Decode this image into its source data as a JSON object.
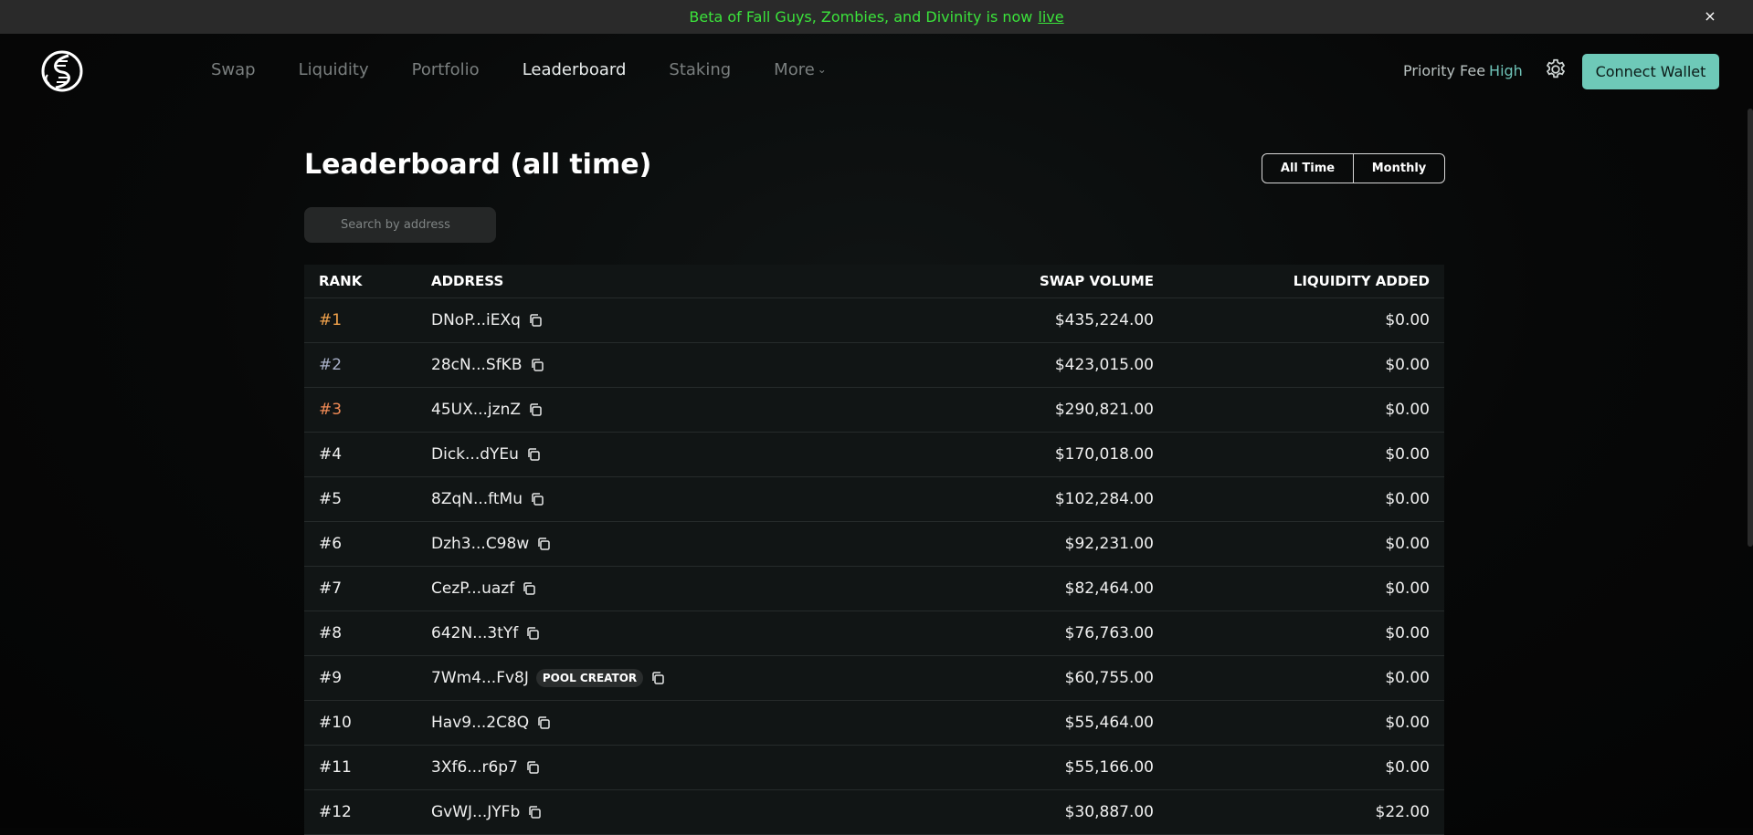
{
  "banner": {
    "text": "Beta of Fall Guys, Zombies, and Divinity is now",
    "link": "live",
    "close": "×"
  },
  "nav": {
    "items": [
      {
        "label": "Swap",
        "active": false
      },
      {
        "label": "Liquidity",
        "active": false
      },
      {
        "label": "Portfolio",
        "active": false
      },
      {
        "label": "Leaderboard",
        "active": true
      },
      {
        "label": "Staking",
        "active": false
      },
      {
        "label": "More",
        "active": false
      }
    ],
    "priority_label": "Priority Fee",
    "priority_level": "High",
    "connect_label": "Connect Wallet"
  },
  "main": {
    "title": "Leaderboard (all time)",
    "toggle": [
      "All Time",
      "Monthly"
    ],
    "search_placeholder": "Search by address"
  },
  "table": {
    "headers": [
      "RANK",
      "ADDRESS",
      "SWAP VOLUME",
      "LIQUIDITY ADDED"
    ],
    "rows": [
      {
        "rank": "#1",
        "address": "DNoP...iEXq",
        "badge": "",
        "volume": "$435,224.00",
        "liquidity": "$0.00"
      },
      {
        "rank": "#2",
        "address": "28cN...SfKB",
        "badge": "",
        "volume": "$423,015.00",
        "liquidity": "$0.00"
      },
      {
        "rank": "#3",
        "address": "45UX...jznZ",
        "badge": "",
        "volume": "$290,821.00",
        "liquidity": "$0.00"
      },
      {
        "rank": "#4",
        "address": "Dick...dYEu",
        "badge": "",
        "volume": "$170,018.00",
        "liquidity": "$0.00"
      },
      {
        "rank": "#5",
        "address": "8ZqN...ftMu",
        "badge": "",
        "volume": "$102,284.00",
        "liquidity": "$0.00"
      },
      {
        "rank": "#6",
        "address": "Dzh3...C98w",
        "badge": "",
        "volume": "$92,231.00",
        "liquidity": "$0.00"
      },
      {
        "rank": "#7",
        "address": "CezP...uazf",
        "badge": "",
        "volume": "$82,464.00",
        "liquidity": "$0.00"
      },
      {
        "rank": "#8",
        "address": "642N...3tYf",
        "badge": "",
        "volume": "$76,763.00",
        "liquidity": "$0.00"
      },
      {
        "rank": "#9",
        "address": "7Wm4...Fv8J",
        "badge": "POOL CREATOR",
        "volume": "$60,755.00",
        "liquidity": "$0.00"
      },
      {
        "rank": "#10",
        "address": "Hav9...2C8Q",
        "badge": "",
        "volume": "$55,464.00",
        "liquidity": "$0.00"
      },
      {
        "rank": "#11",
        "address": "3Xf6...r6p7",
        "badge": "",
        "volume": "$55,166.00",
        "liquidity": "$0.00"
      },
      {
        "rank": "#12",
        "address": "GvWJ...JYFb",
        "badge": "",
        "volume": "$30,887.00",
        "liquidity": "$22.00"
      }
    ]
  },
  "colors": {
    "accent": "#6ec9b8",
    "banner_text": "#3be33b",
    "rank1": "#f0a14b",
    "rank2": "#a8b0c8",
    "rank3": "#f08a55"
  },
  "icons": {
    "logo": "dna-s-logo-icon",
    "settings": "gear-icon",
    "copy": "copy-icon",
    "close": "close-icon",
    "more": "chevron-down-icon"
  }
}
